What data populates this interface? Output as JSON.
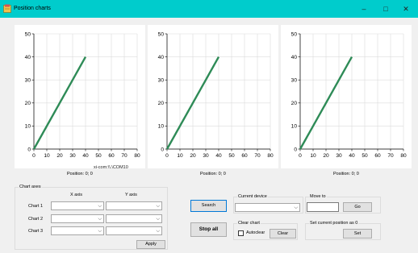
{
  "window": {
    "title": "Position charts",
    "icon": "app-icon",
    "minimize_glyph": "–",
    "maximize_glyph": "□",
    "close_glyph": "✕"
  },
  "charts": [
    {
      "port": "xi-com:\\\\.\\COM10",
      "position_text": "Position: 0; 0"
    },
    {
      "port": "",
      "position_text": "Position: 0; 0"
    },
    {
      "port": "",
      "position_text": "Position: 0; 0"
    }
  ],
  "chart_data": [
    {
      "type": "line",
      "x": [
        0,
        40
      ],
      "y": [
        0,
        40
      ],
      "xlim": [
        0,
        80
      ],
      "ylim": [
        0,
        50
      ],
      "xticks": [
        "0",
        "10",
        "20",
        "30",
        "40",
        "50",
        "60",
        "70",
        "80"
      ],
      "yticks": [
        "0",
        "10",
        "20",
        "30",
        "40",
        "50"
      ],
      "grid": true,
      "line_color": "#2e8b57"
    },
    {
      "type": "line",
      "x": [
        0,
        40
      ],
      "y": [
        0,
        40
      ],
      "xlim": [
        0,
        80
      ],
      "ylim": [
        0,
        50
      ],
      "xticks": [
        "0",
        "10",
        "20",
        "30",
        "40",
        "50",
        "60",
        "70",
        "80"
      ],
      "yticks": [
        "0",
        "10",
        "20",
        "30",
        "40",
        "50"
      ],
      "grid": true,
      "line_color": "#2e8b57"
    },
    {
      "type": "line",
      "x": [
        0,
        40
      ],
      "y": [
        0,
        40
      ],
      "xlim": [
        0,
        80
      ],
      "ylim": [
        0,
        50
      ],
      "xticks": [
        "0",
        "10",
        "20",
        "30",
        "40",
        "50",
        "60",
        "70",
        "80"
      ],
      "yticks": [
        "0",
        "10",
        "20",
        "30",
        "40",
        "50"
      ],
      "grid": true,
      "line_color": "#2e8b57"
    }
  ],
  "chart_axes": {
    "title": "Chart axes",
    "x_header": "X axis",
    "y_header": "Y axis",
    "rows": [
      {
        "label": "Chart 1",
        "x_value": "",
        "y_value": ""
      },
      {
        "label": "Chart 2",
        "x_value": "",
        "y_value": ""
      },
      {
        "label": "Chart 3",
        "x_value": "",
        "y_value": ""
      }
    ],
    "apply_label": "Apply"
  },
  "actions": {
    "search_label": "Search",
    "stop_all_label": "Stop all"
  },
  "current_device": {
    "title": "Current device",
    "value": ""
  },
  "move_to": {
    "title": "Move to",
    "value": "",
    "go_label": "Go"
  },
  "clear_chart": {
    "title": "Clear chart",
    "autoclear_label": "Autoclear",
    "autoclear_checked": false,
    "clear_label": "Clear"
  },
  "set_position": {
    "title": "Set current position as 0",
    "set_label": "Set"
  }
}
